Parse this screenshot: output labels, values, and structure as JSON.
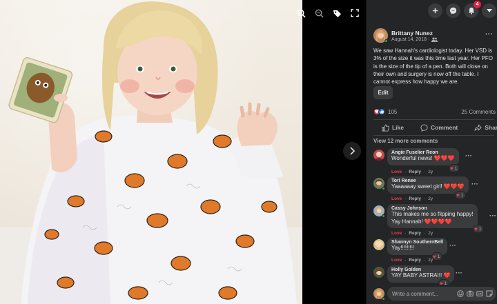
{
  "viewer": {
    "controls": [
      "zoom-in-icon",
      "zoom-out-icon",
      "tag-icon",
      "fullscreen-icon"
    ],
    "next": "chevron-right-icon"
  },
  "topbar": {
    "notification_count": "4"
  },
  "post": {
    "author": "Brittany Nunez",
    "date": "August 14, 2018 ·",
    "privacy_icon": "friends-icon",
    "text": "We saw Hannah's cardiologist today. Her VSD is 3% of the size it was this time last year. Her PFO is the size of the tip of a pen. Both will close on their own and surgery is now off the table. I cannot express how happy we are.",
    "edit_label": "Edit",
    "reaction_count": "105",
    "comments_count": "25 Comments",
    "actions": {
      "like": "Like",
      "comment": "Comment",
      "share": "Share"
    },
    "view_more": "View 12 more comments"
  },
  "comments": [
    {
      "name": "Angie Fuselier Reon",
      "text": "Wonderful news! ❤️❤️❤️",
      "love": "Love",
      "reply": "Reply",
      "time": "2y",
      "reacts": "1"
    },
    {
      "name": "Tori Renee",
      "text": "Yaaaaaay sweet girl! ❤️❤️❤️",
      "love": "Love",
      "reply": "Reply",
      "time": "2y",
      "reacts": "1"
    },
    {
      "name": "Cassy Johnson",
      "text_lines": [
        "This makes me so flipping happy!",
        "Yay Hannah! ❤️❤️❤️❤️"
      ],
      "love": "Love",
      "reply": "Reply",
      "time": "2y",
      "reacts": "1"
    },
    {
      "name": "Shannyn SouthernBell",
      "text": "Yay!!!!!!!!!",
      "love": "Love",
      "reply": "Reply",
      "time": "2y",
      "reacts": "1"
    },
    {
      "name": "Holly Golden",
      "text": "YAY BABY ASTRA!!! ❤️",
      "love": "Love",
      "reply": "Reply",
      "time": "2y",
      "reacts": "1"
    }
  ],
  "composer": {
    "placeholder": "Write a comment...",
    "icons": [
      "emoji-icon",
      "camera-icon",
      "gif-icon",
      "sticker-icon"
    ]
  }
}
